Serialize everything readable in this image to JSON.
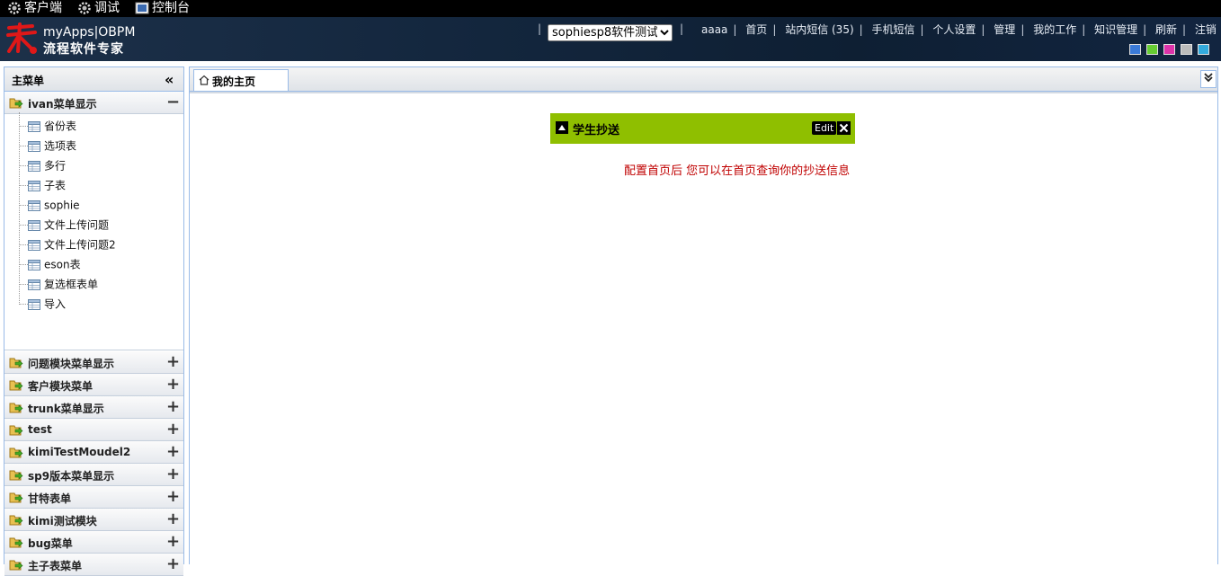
{
  "topbar": {
    "items": [
      {
        "label": "客户端",
        "icon": "gear-icon"
      },
      {
        "label": "调试",
        "icon": "gear-icon"
      },
      {
        "label": "控制台",
        "icon": "console-icon"
      }
    ]
  },
  "header": {
    "logo_line1": "myApps|OBPM",
    "logo_line2": "流程软件专家",
    "app_selector": {
      "selected": "sophiesp8软件测试"
    },
    "nav": [
      "aaaa",
      "首页",
      "站内短信 (35)",
      "手机短信",
      "个人设置",
      "管理",
      "我的工作",
      "知识管理",
      "刷新",
      "注销"
    ],
    "theme_colors": [
      "#3a7ad8",
      "#66cc33",
      "#dd33aa",
      "#bbbbbb",
      "#33aadd"
    ]
  },
  "sidebar": {
    "title": "主菜单",
    "expanded_group": {
      "label": "ivan菜单显示",
      "toggle": "−",
      "items": [
        "省份表",
        "选项表",
        "多行",
        "子表",
        "sophie",
        "文件上传问题",
        "文件上传问题2",
        "eson表",
        "复选框表单",
        "导入"
      ]
    },
    "groups": [
      {
        "label": "问题模块菜单显示"
      },
      {
        "label": "客户模块菜单"
      },
      {
        "label": "trunk菜单显示"
      },
      {
        "label": "test"
      },
      {
        "label": "kimiTestMoudel2"
      },
      {
        "label": "sp9版本菜单显示"
      },
      {
        "label": "甘特表单"
      },
      {
        "label": "kimi测试模块"
      },
      {
        "label": "bug菜单"
      },
      {
        "label": "主子表菜单"
      }
    ],
    "collapsed_toggle": "+"
  },
  "main": {
    "tab_label": "我的主页",
    "widget": {
      "title": "学生抄送",
      "edit_label": "Edit",
      "message": "配置首页后 您可以在首页查询你的抄送信息"
    }
  }
}
